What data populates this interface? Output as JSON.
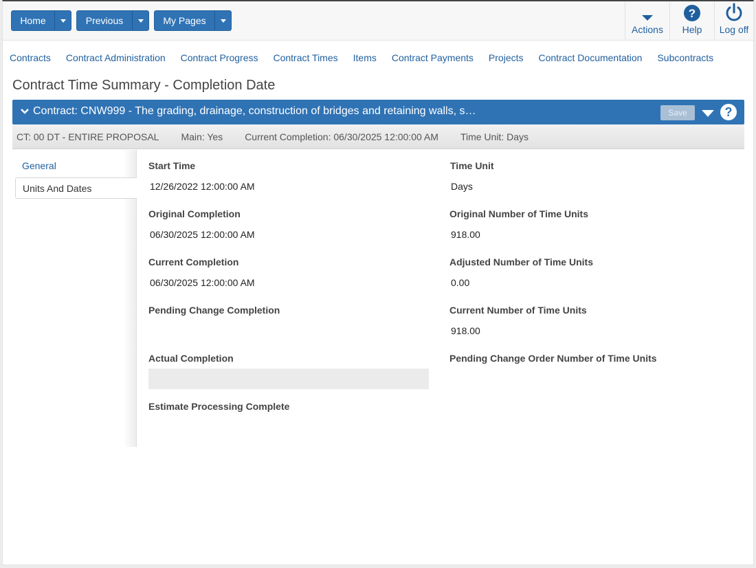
{
  "toolbar": {
    "home_label": "Home",
    "previous_label": "Previous",
    "mypages_label": "My Pages",
    "actions_label": "Actions",
    "help_label": "Help",
    "logoff_label": "Log off"
  },
  "nav": {
    "items": [
      "Contracts",
      "Contract Administration",
      "Contract Progress",
      "Contract Times",
      "Items",
      "Contract Payments",
      "Projects",
      "Contract Documentation",
      "Subcontracts"
    ]
  },
  "page": {
    "title": "Contract Time Summary - Completion Date"
  },
  "contract_bar": {
    "title": "Contract: CNW999 - The grading, drainage, construction of bridges and retaining walls, s…",
    "save_label": "Save",
    "help_glyph": "?"
  },
  "info": {
    "ct": "CT: 00 DT - ENTIRE PROPOSAL",
    "main": "Main: Yes",
    "current_completion": "Current Completion: 06/30/2025 12:00:00 AM",
    "time_unit": "Time Unit: Days"
  },
  "tabs": {
    "general": "General",
    "units_and_dates": "Units And Dates"
  },
  "fields": {
    "start_time_label": "Start Time",
    "start_time_value": "12/26/2022 12:00:00 AM",
    "original_completion_label": "Original Completion",
    "original_completion_value": "06/30/2025 12:00:00 AM",
    "current_completion_label": "Current Completion",
    "current_completion_value": "06/30/2025 12:00:00 AM",
    "pending_change_completion_label": "Pending Change Completion",
    "actual_completion_label": "Actual Completion",
    "estimate_processing_label": "Estimate Processing Complete",
    "time_unit_label": "Time Unit",
    "time_unit_value": "Days",
    "original_units_label": "Original Number of Time Units",
    "original_units_value": "918.00",
    "adjusted_units_label": "Adjusted Number of Time Units",
    "adjusted_units_value": "0.00",
    "current_units_label": "Current Number of Time Units",
    "current_units_value": "918.00",
    "pending_co_units_label": "Pending Change Order Number of Time Units"
  },
  "colors": {
    "primary": "#2f73b5",
    "link": "#1f5f9e"
  }
}
